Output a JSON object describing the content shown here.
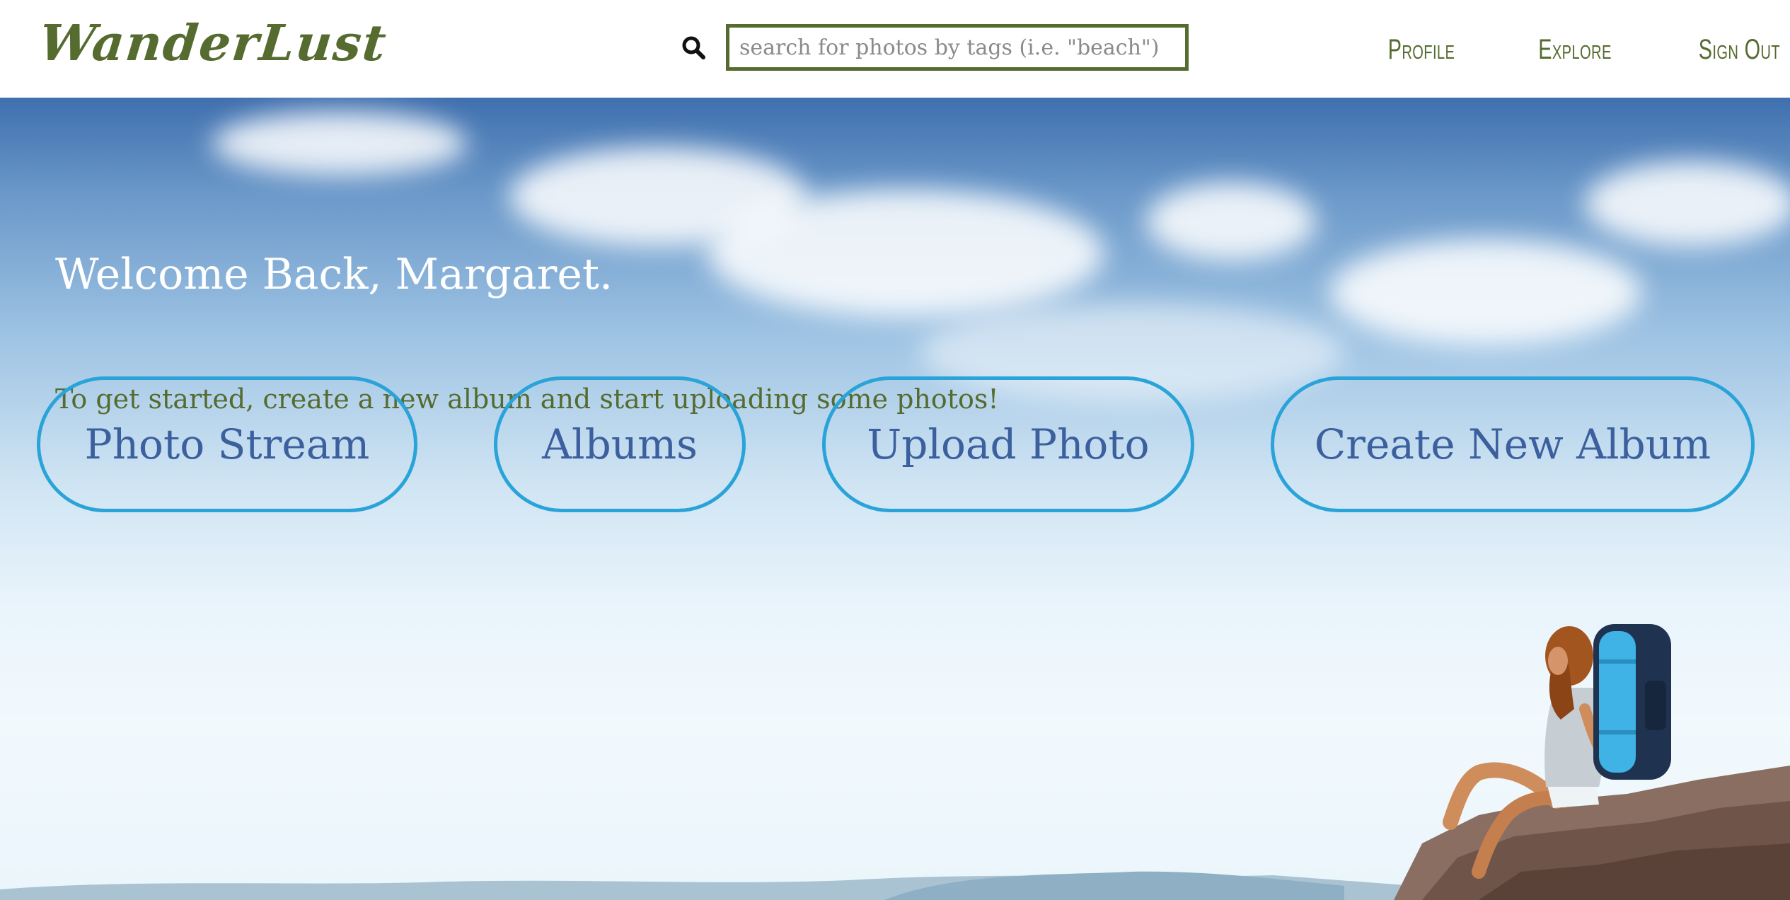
{
  "header": {
    "logo_text": "WanderLust",
    "search": {
      "placeholder": "search for photos by tags (i.e. \"beach\")",
      "value": ""
    },
    "nav": [
      "Profile",
      "Explore",
      "Sign Out"
    ]
  },
  "hero": {
    "welcome": "Welcome Back, Margaret.",
    "intro": "To get started, create a new album and start uploading some photos!",
    "buttons": {
      "photo_stream": "Photo Stream",
      "albums": "Albums",
      "upload_photo": "Upload Photo",
      "create_new_album": "Create New Album"
    }
  },
  "colors": {
    "brand_green": "#556b2f",
    "button_border": "#29a3d8",
    "button_text": "#3c5f9e"
  },
  "icons": {
    "search": "search-icon"
  }
}
